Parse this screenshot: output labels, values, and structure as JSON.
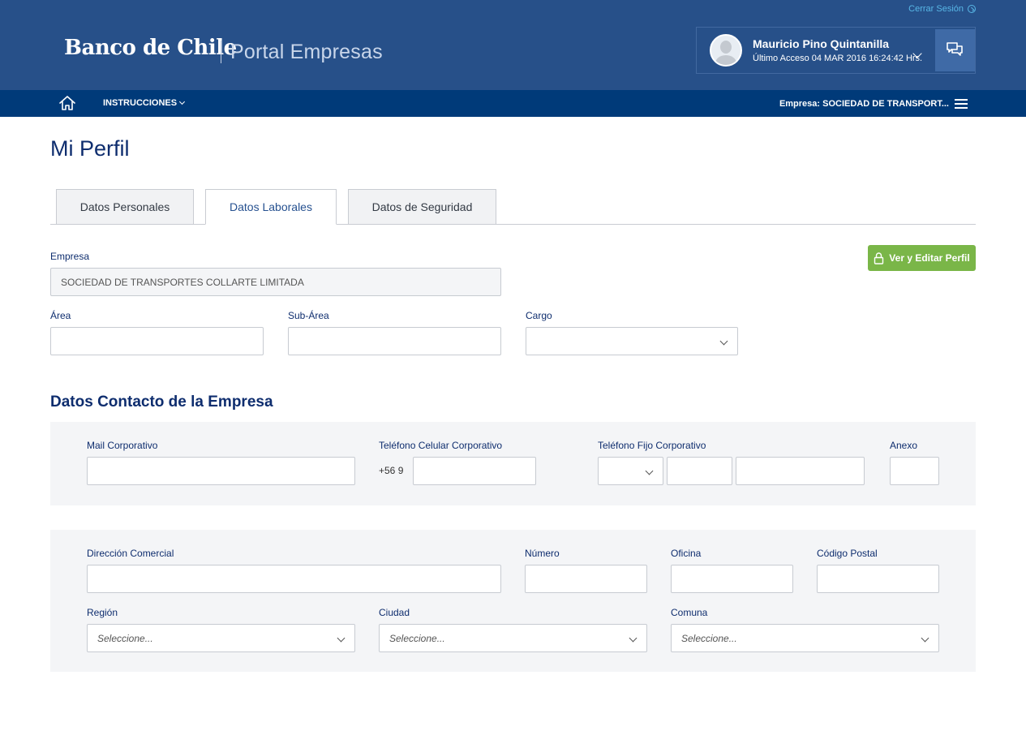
{
  "header": {
    "logout_label": "Cerrar Sesión",
    "logo_text": "Banco de Chile",
    "portal_title": "Portal Empresas",
    "user_name": "Mauricio Pino Quintanilla",
    "last_access": "Último Acceso 04 MAR 2016 16:24:42 Hrs."
  },
  "nav": {
    "menu_label": "INSTRUCCIONES",
    "company_prefix": "Empresa:",
    "company_value": "SOCIEDAD DE TRANSPORT..."
  },
  "page": {
    "title": "Mi Perfil",
    "tabs": [
      {
        "label": "Datos Personales",
        "active": false
      },
      {
        "label": "Datos Laborales",
        "active": true
      },
      {
        "label": "Datos de Seguridad",
        "active": false
      }
    ],
    "edit_button": "Ver y Editar Perfil"
  },
  "work": {
    "empresa_label": "Empresa",
    "empresa_value": "SOCIEDAD DE TRANSPORTES COLLARTE LIMITADA",
    "area_label": "Área",
    "area_value": "",
    "subarea_label": "Sub-Área",
    "subarea_value": "",
    "cargo_label": "Cargo",
    "cargo_value": ""
  },
  "contact": {
    "section_title": "Datos Contacto de la Empresa",
    "mail_label": "Mail Corporativo",
    "mail_value": "",
    "cell_label": "Teléfono Celular Corporativo",
    "cell_prefix": "+56 9",
    "cell_value": "",
    "phone_label": "Teléfono Fijo Corporativo",
    "phone_code": "",
    "phone_area": "",
    "phone_number": "",
    "ext_label": "Anexo",
    "ext_value": ""
  },
  "address": {
    "street_label": "Dirección Comercial",
    "street_value": "",
    "number_label": "Número",
    "number_value": "",
    "office_label": "Oficina",
    "office_value": "",
    "postal_label": "Código Postal",
    "postal_value": "",
    "region_label": "Región",
    "region_placeholder": "Seleccione...",
    "city_label": "Ciudad",
    "city_placeholder": "Seleccione...",
    "commune_label": "Comuna",
    "commune_placeholder": "Seleccione..."
  },
  "colors": {
    "header_bg": "#275089",
    "nav_bg": "#003a79",
    "accent_green": "#7ab648",
    "link_blue": "#58b7e6"
  }
}
